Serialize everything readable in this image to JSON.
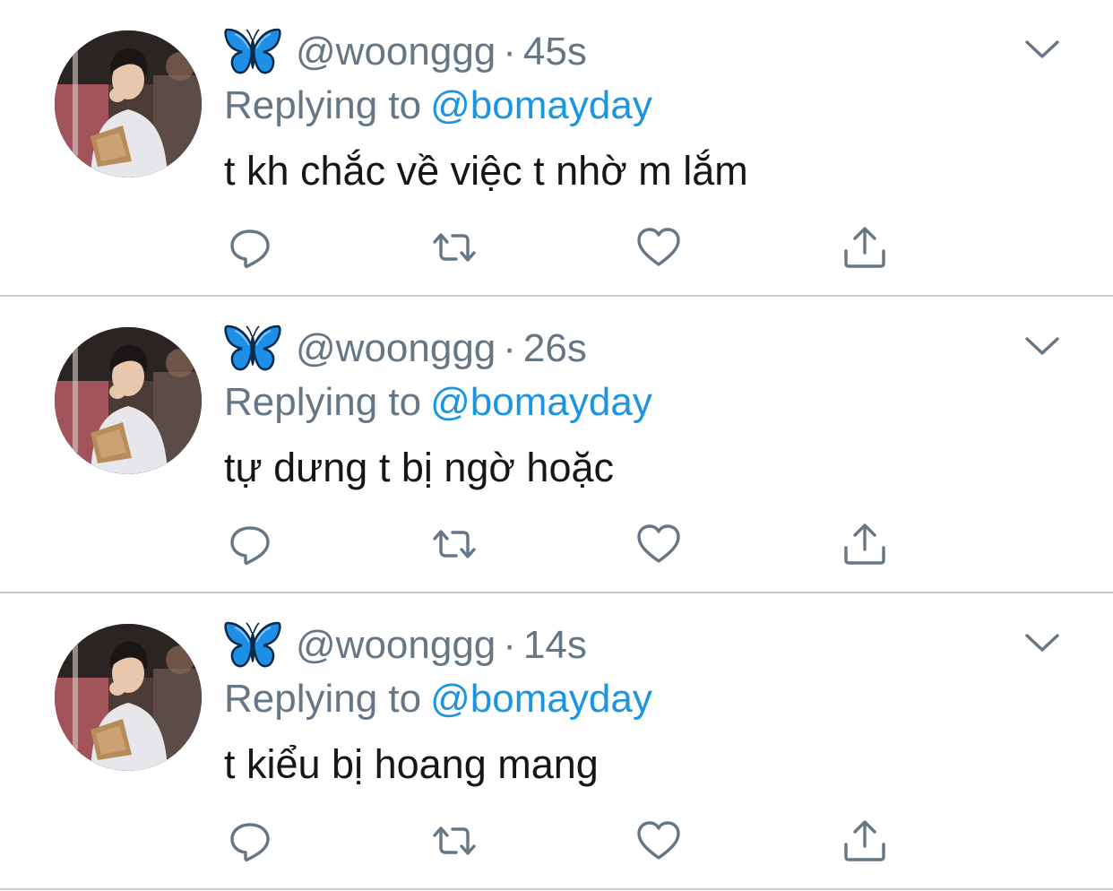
{
  "tweets": [
    {
      "handle": "@woonggg",
      "separator": "·",
      "time": "45s",
      "replying_label": "Replying to",
      "replying_to": "@bomayday",
      "text": "t kh chắc về việc t nhờ m lắm"
    },
    {
      "handle": "@woonggg",
      "separator": "·",
      "time": "26s",
      "replying_label": "Replying to",
      "replying_to": "@bomayday",
      "text": "tự dưng t bị ngờ hoặc"
    },
    {
      "handle": "@woonggg",
      "separator": "·",
      "time": "14s",
      "replying_label": "Replying to",
      "replying_to": "@bomayday",
      "text": "t kiểu bị hoang mang"
    }
  ],
  "icons": {
    "name_emoji": "butterfly-icon",
    "more": "chevron-down-icon",
    "actions": [
      "reply-icon",
      "retweet-icon",
      "like-icon",
      "share-icon"
    ]
  },
  "colors": {
    "secondary_text": "#657786",
    "link": "#1b95e0",
    "primary_text": "#14171a",
    "icon": "#657786",
    "divider": "#c8ccd1",
    "butterfly_blue": "#1e8fe6"
  }
}
